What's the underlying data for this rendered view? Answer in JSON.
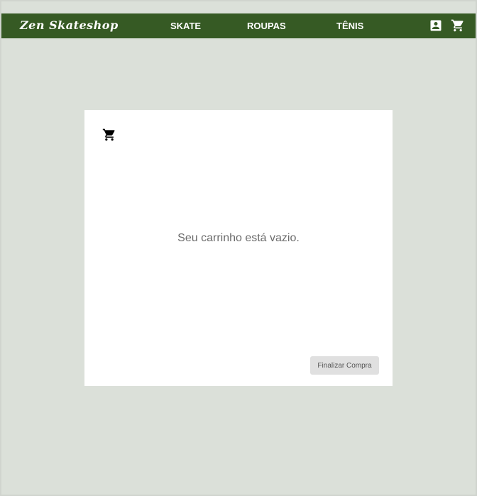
{
  "header": {
    "brand": "Zen Skateshop",
    "nav": [
      {
        "label": "SKATE"
      },
      {
        "label": "ROUPAS"
      },
      {
        "label": "TÊNIS"
      }
    ],
    "icons": {
      "account": "account-box-icon",
      "cart": "shopping-cart-icon"
    }
  },
  "cart": {
    "icon": "shopping-cart-icon",
    "empty_message": "Seu carrinho está vazio.",
    "checkout_label": "Finalizar Compra"
  },
  "colors": {
    "page_background": "#dbe0d9",
    "navbar": "#365a24",
    "panel": "#ffffff",
    "button": "#e0e0e0"
  }
}
